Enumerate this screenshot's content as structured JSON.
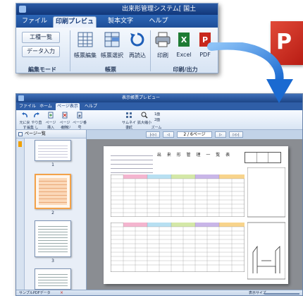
{
  "ribbon": {
    "app_title": "出来形管理システム[ 国土",
    "tabs": [
      "ファイル",
      "印刷プレビュー",
      "製本文字",
      "ヘルプ"
    ],
    "buttons": {
      "process_list": "工種一覧",
      "data_input": "データ入力",
      "form_edit": "帳票編集",
      "form_select": "帳票選択",
      "reload": "再読込",
      "print": "印刷",
      "excel": "Excel",
      "pdf": "PDF"
    },
    "groups": [
      "編集モード",
      "帳票",
      "印刷/出力"
    ]
  },
  "pdf_logo_letter": "P",
  "preview": {
    "title": "表示帳票プレビュー",
    "tabs": [
      "ファイル",
      "ホーム",
      "ページ表示",
      "ヘルプ"
    ],
    "ribbon_buttons": [
      "元に戻す",
      "やり直し",
      "ページ挿入",
      "ページ削除",
      "ページ番号",
      "サムネイル",
      "拡大縮小",
      "1面",
      "2面"
    ],
    "ribbon_groups": [
      "編集",
      "ページ",
      "書式",
      "ズーム"
    ],
    "thumbnails_header": "ページ一覧",
    "thumbnail_numbers": [
      "1",
      "2",
      "3",
      "4"
    ],
    "nav": {
      "first": "|◁◁",
      "prev": "◁",
      "page_indicator": "2 / 6ページ",
      "next": "▷",
      "last": "▷▷|"
    },
    "doc_title": "出 来 形 管 理 一 覧 表",
    "status_left": "サンプルPDFデータ",
    "status_right": "表示サイズ"
  },
  "colors": {
    "ribbon_blue": "#1f4f98",
    "arrow_blue": "#1a6ad1",
    "pdf_red": "#c8271c",
    "excel_green": "#1e7b34"
  }
}
